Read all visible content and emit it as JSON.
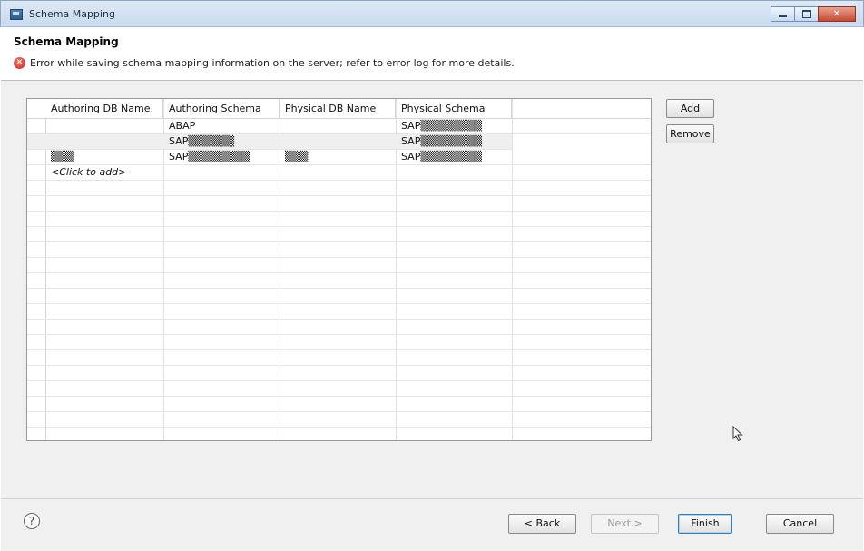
{
  "window": {
    "title": "Schema Mapping",
    "controls": {
      "minimize": "–",
      "maximize": "□",
      "close": "✕"
    }
  },
  "header": {
    "title": "Schema Mapping",
    "error_icon": "error-icon",
    "error_message": "Error while saving schema mapping information on the server; refer to error log for more details."
  },
  "table": {
    "columns": [
      "Authoring DB Name",
      "Authoring Schema",
      "Physical DB Name",
      "Physical Schema"
    ],
    "rows": [
      {
        "authoring_db": "",
        "authoring_schema": "ABAP",
        "physical_db": "",
        "physical_schema": "SAP▒▒▒▒▒▒▒▒",
        "selected": false
      },
      {
        "authoring_db": "",
        "authoring_schema": "SAP▒▒▒▒▒▒",
        "physical_db": "",
        "physical_schema": "SAP▒▒▒▒▒▒▒▒",
        "selected": true
      },
      {
        "authoring_db": "▒▒▒",
        "authoring_schema": "SAP▒▒▒▒▒▒▒▒",
        "physical_db": "▒▒▒",
        "physical_schema": "SAP▒▒▒▒▒▒▒▒",
        "selected": false
      }
    ],
    "add_row_label": "<Click to add>"
  },
  "side_buttons": {
    "add": "Add",
    "remove": "Remove"
  },
  "footer": {
    "help_icon": "help-icon",
    "help_glyph": "?",
    "back": "< Back",
    "next": "Next >",
    "finish": "Finish",
    "cancel": "Cancel"
  }
}
